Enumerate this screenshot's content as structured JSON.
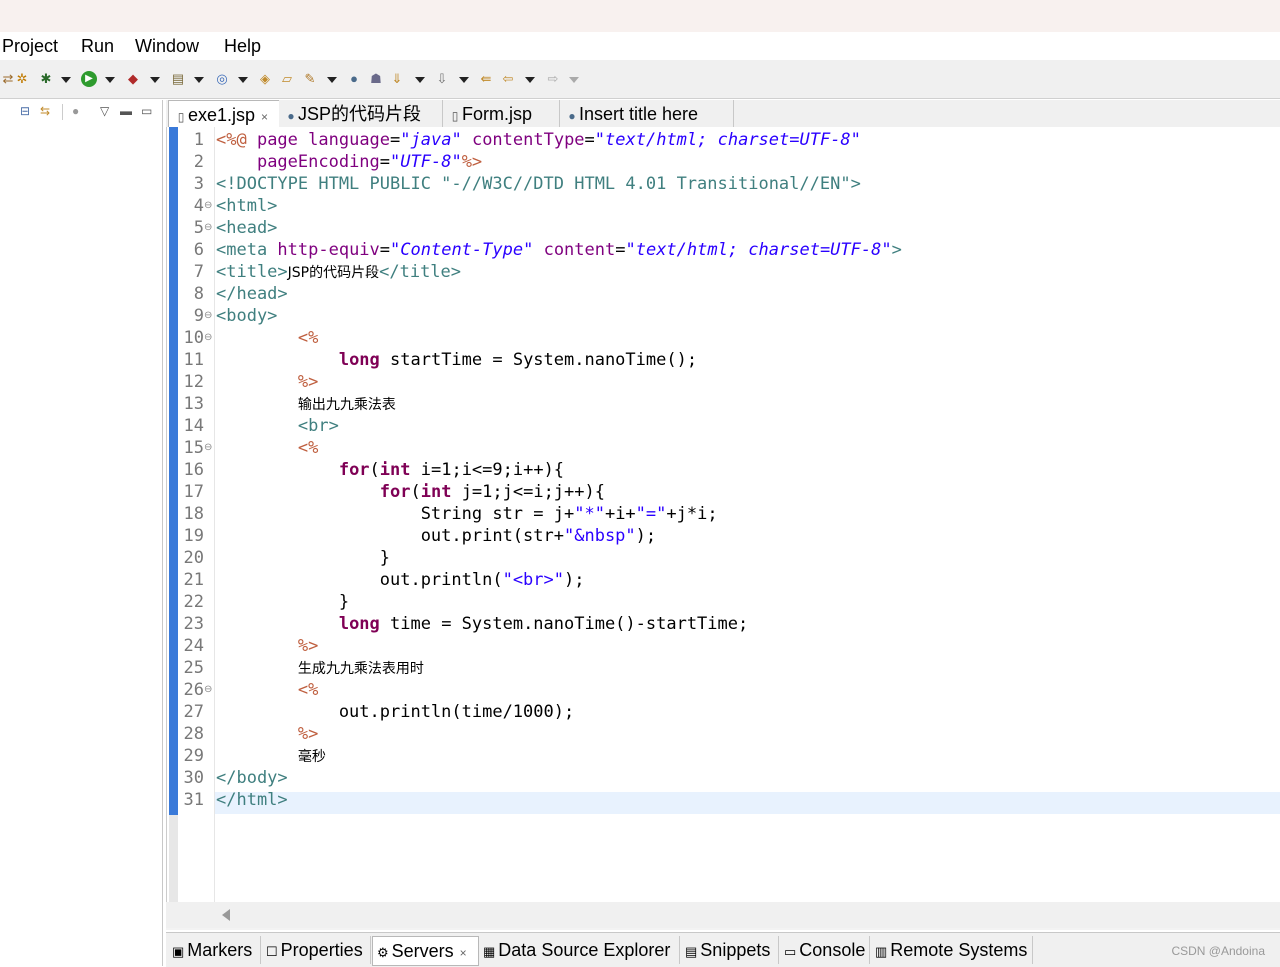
{
  "menu": [
    "Project",
    "Run",
    "Window",
    "Help"
  ],
  "toolbar_icons": [
    "debug-icon",
    "bug-icon",
    "run-icon",
    "coverage-icon",
    "new-server-icon",
    "web-browser-icon",
    "open-type-icon",
    "open-folder-icon",
    "search-icon",
    "globe-icon",
    "team-icon",
    "annotation-icon",
    "next-annotation-icon",
    "back-icon",
    "forward-icon"
  ],
  "tabs": [
    {
      "label": "exe1.jsp",
      "icon": "file-icon",
      "close": "×",
      "active": true
    },
    {
      "label": "JSP的代码片段",
      "icon": "globe-icon"
    },
    {
      "label": "Form.jsp",
      "icon": "file-icon"
    },
    {
      "label": "Insert title here",
      "icon": "globe-icon"
    }
  ],
  "line_numbers": [
    "1",
    "2",
    "3",
    "4",
    "5",
    "6",
    "7",
    "8",
    "9",
    "10",
    "11",
    "12",
    "13",
    "14",
    "15",
    "16",
    "17",
    "18",
    "19",
    "20",
    "21",
    "22",
    "23",
    "24",
    "25",
    "26",
    "27",
    "28",
    "29",
    "30",
    "31"
  ],
  "fold_markers": [
    "4",
    "5",
    "9",
    "10",
    "15",
    "26"
  ],
  "code_lines": [
    [
      [
        "jsp",
        "<%@ "
      ],
      [
        "attr",
        "page "
      ],
      [
        "attr",
        "language"
      ],
      [
        "",
        "="
      ],
      [
        "str",
        "\"java\""
      ],
      [
        "",
        " "
      ],
      [
        "attr",
        "contentType"
      ],
      [
        "",
        "="
      ],
      [
        "str",
        "\"text/html; charset=UTF-8\""
      ]
    ],
    [
      [
        "",
        "    "
      ],
      [
        "attr",
        "pageEncoding"
      ],
      [
        "",
        "="
      ],
      [
        "str",
        "\"UTF-8\""
      ],
      [
        "jsp",
        "%>"
      ]
    ],
    [
      [
        "tag",
        "<!DOCTYPE HTML PUBLIC "
      ],
      [
        "tag",
        "\"-//W3C//DTD HTML 4.01 Transitional//EN\">"
      ]
    ],
    [
      [
        "tag",
        "<html>"
      ]
    ],
    [
      [
        "tag",
        "<head>"
      ]
    ],
    [
      [
        "tag",
        "<meta "
      ],
      [
        "attr",
        "http-equiv"
      ],
      [
        "",
        "="
      ],
      [
        "str",
        "\"Content-Type\""
      ],
      [
        "",
        " "
      ],
      [
        "attr",
        "content"
      ],
      [
        "",
        "="
      ],
      [
        "str",
        "\"text/html; charset=UTF-8\""
      ],
      [
        "tag",
        ">"
      ]
    ],
    [
      [
        "tag",
        "<title>"
      ],
      [
        "cn",
        "JSP的代码片段"
      ],
      [
        "tag",
        "</title>"
      ]
    ],
    [
      [
        "tag",
        "</head>"
      ]
    ],
    [
      [
        "tag",
        "<body>"
      ]
    ],
    [
      [
        "",
        "        "
      ],
      [
        "jsp",
        "<%"
      ]
    ],
    [
      [
        "",
        "            "
      ],
      [
        "kw",
        "long"
      ],
      [
        "",
        " startTime = System.nanoTime();"
      ]
    ],
    [
      [
        "",
        "        "
      ],
      [
        "jsp",
        "%>"
      ]
    ],
    [
      [
        "",
        "        "
      ],
      [
        "cn",
        "输出九九乘法表"
      ]
    ],
    [
      [
        "",
        "        "
      ],
      [
        "tag",
        "<br>"
      ]
    ],
    [
      [
        "",
        "        "
      ],
      [
        "jsp",
        "<%"
      ]
    ],
    [
      [
        "",
        "            "
      ],
      [
        "kw",
        "for"
      ],
      [
        "",
        "("
      ],
      [
        "kw",
        "int"
      ],
      [
        "",
        " i=1;i<=9;i++){"
      ]
    ],
    [
      [
        "",
        "                "
      ],
      [
        "kw",
        "for"
      ],
      [
        "",
        "("
      ],
      [
        "kw",
        "int"
      ],
      [
        "",
        " j=1;j<=i;j++){"
      ]
    ],
    [
      [
        "",
        "                    String str = j+"
      ],
      [
        "jstr",
        "\"*\""
      ],
      [
        "",
        "+i+"
      ],
      [
        "jstr",
        "\"=\""
      ],
      [
        "",
        "+j*i;"
      ]
    ],
    [
      [
        "",
        "                    out.print(str+"
      ],
      [
        "jstr",
        "\"&nbsp\""
      ],
      [
        "",
        ");"
      ]
    ],
    [
      [
        "",
        "                }"
      ]
    ],
    [
      [
        "",
        "                out.println("
      ],
      [
        "jstr",
        "\"<br>\""
      ],
      [
        "",
        ");"
      ]
    ],
    [
      [
        "",
        "            }"
      ]
    ],
    [
      [
        "",
        "            "
      ],
      [
        "kw",
        "long"
      ],
      [
        "",
        " time = System.nanoTime()-startTime;"
      ]
    ],
    [
      [
        "",
        "        "
      ],
      [
        "jsp",
        "%>"
      ]
    ],
    [
      [
        "",
        "        "
      ],
      [
        "cn",
        "生成九九乘法表用时"
      ]
    ],
    [
      [
        "",
        "        "
      ],
      [
        "jsp",
        "<%"
      ]
    ],
    [
      [
        "",
        "            out.println(time/1000);"
      ]
    ],
    [
      [
        "",
        "        "
      ],
      [
        "jsp",
        "%>"
      ]
    ],
    [
      [
        "",
        "        "
      ],
      [
        "cn",
        "毫秒"
      ]
    ],
    [
      [
        "tag",
        "</body>"
      ]
    ],
    [
      [
        "tag",
        "</html>"
      ]
    ]
  ],
  "bottom_tabs": [
    {
      "label": "Markers",
      "icon": "markers-icon",
      "glyph": "▣"
    },
    {
      "label": "Properties",
      "icon": "properties-icon",
      "glyph": "☐"
    },
    {
      "label": "Servers",
      "icon": "servers-icon",
      "glyph": "⚙",
      "close": "×",
      "active": true
    },
    {
      "label": "Data Source Explorer",
      "icon": "data-source-icon",
      "glyph": "▦"
    },
    {
      "label": "Snippets",
      "icon": "snippets-icon",
      "glyph": "▤"
    },
    {
      "label": "Console",
      "icon": "console-icon",
      "glyph": "▭"
    },
    {
      "label": "Remote Systems",
      "icon": "remote-systems-icon",
      "glyph": "▥"
    }
  ],
  "watermark": "CSDN @Andoina"
}
